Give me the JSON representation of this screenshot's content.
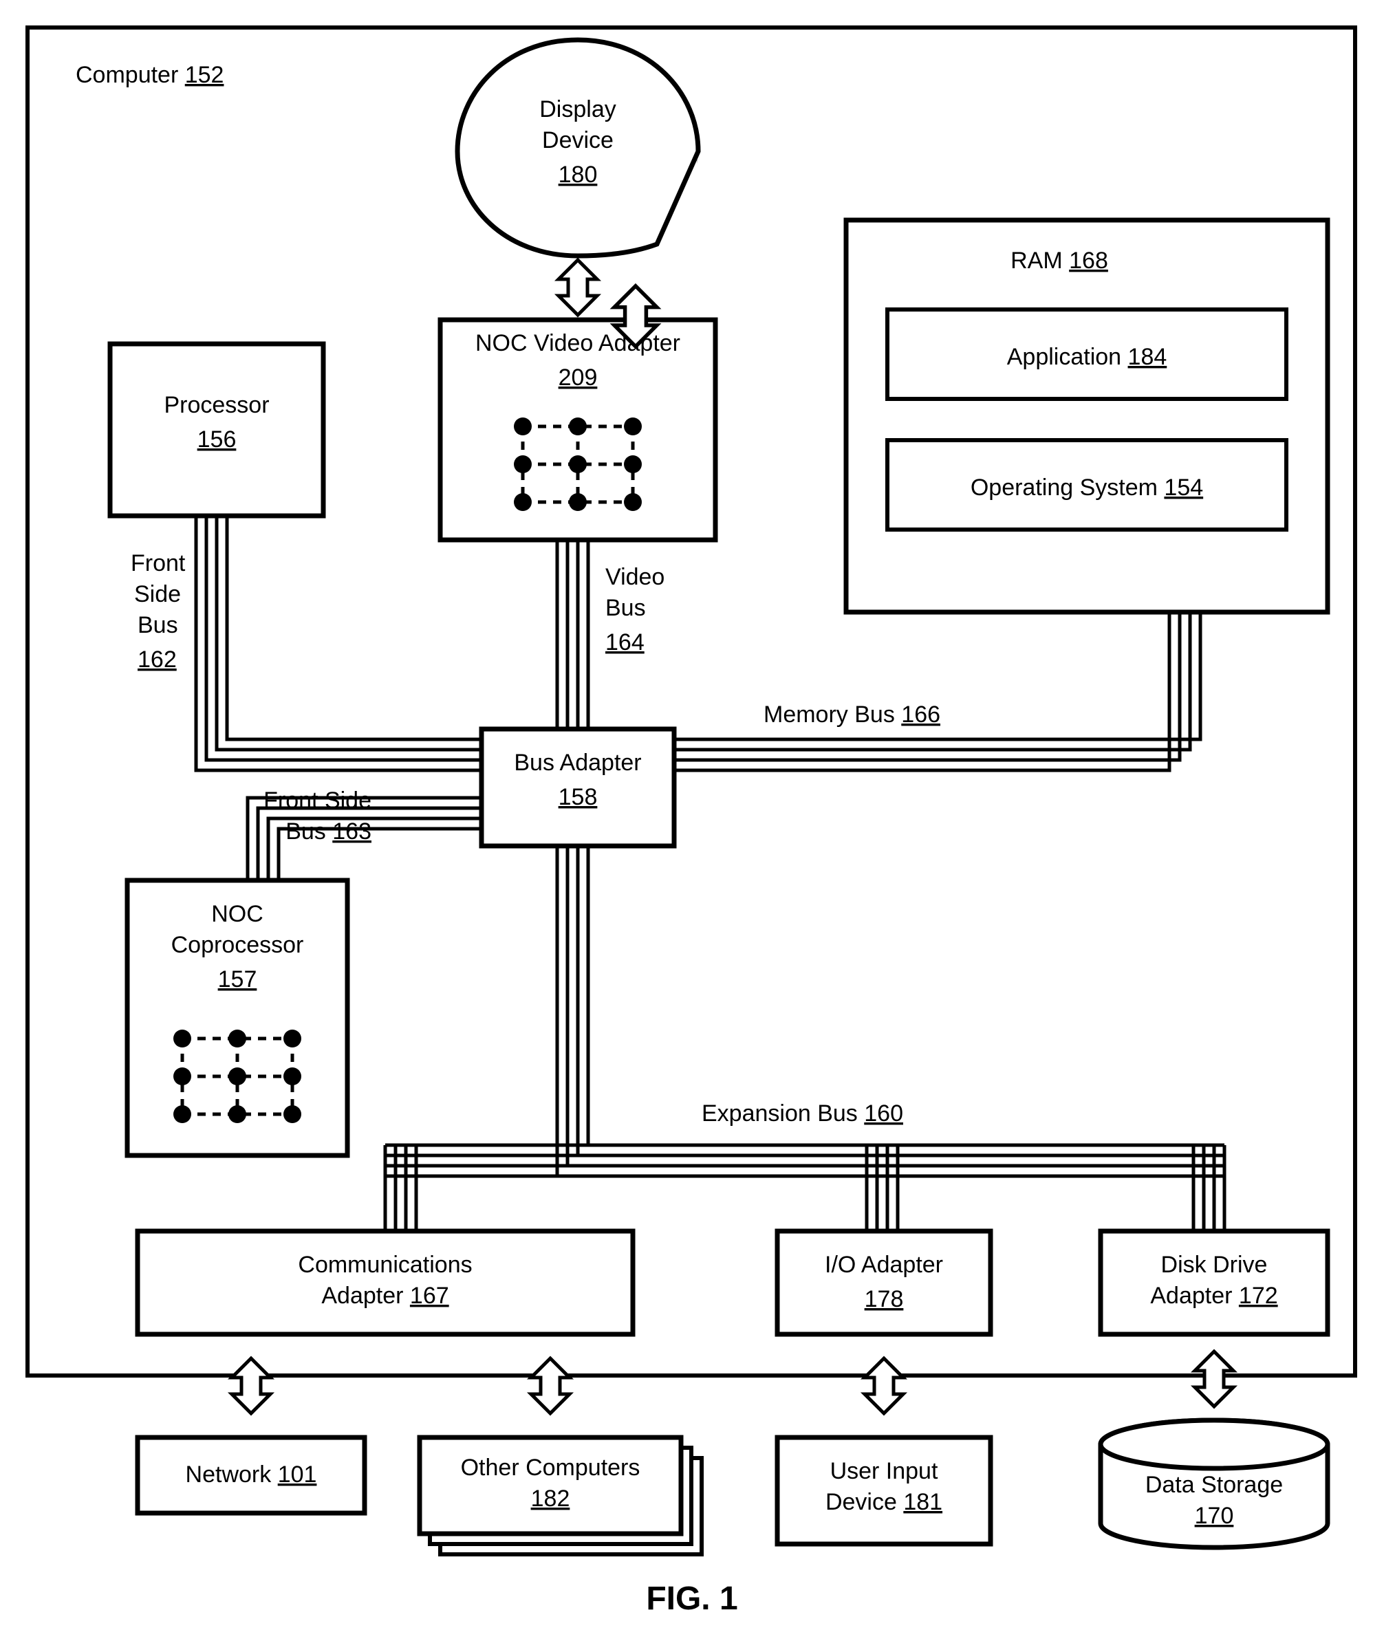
{
  "figure": {
    "label": "FIG. 1"
  },
  "computer": {
    "label": "Computer",
    "ref": "152"
  },
  "display": {
    "label1": "Display",
    "label2": "Device",
    "ref": "180"
  },
  "nocVideo": {
    "label": "NOC Video Adapter",
    "ref": "209"
  },
  "processor": {
    "label": "Processor",
    "ref": "156"
  },
  "ram": {
    "label": "RAM",
    "ref": "168"
  },
  "application": {
    "label": "Application",
    "ref": "184"
  },
  "os": {
    "label": "Operating System",
    "ref": "154"
  },
  "fsb1": {
    "l1": "Front",
    "l2": "Side",
    "l3": "Bus",
    "ref": "162"
  },
  "videoBus": {
    "l1": "Video",
    "l2": "Bus",
    "ref": "164"
  },
  "memBus": {
    "label": "Memory Bus",
    "ref": "166"
  },
  "busAdapter": {
    "label": "Bus Adapter",
    "ref": "158"
  },
  "fsb2": {
    "label": "Front Side",
    "l2": "Bus",
    "ref": "163"
  },
  "nocCop": {
    "l1": "NOC",
    "l2": "Coprocessor",
    "ref": "157"
  },
  "expBus": {
    "label": "Expansion Bus",
    "ref": "160"
  },
  "commAdapter": {
    "l1": "Communications",
    "l2": "Adapter",
    "ref": "167"
  },
  "ioAdapter": {
    "label": "I/O Adapter",
    "ref": "178"
  },
  "diskAdapter": {
    "l1": "Disk Drive",
    "l2": "Adapter",
    "ref": "172"
  },
  "network": {
    "label": "Network",
    "ref": "101"
  },
  "otherComp": {
    "label": "Other Computers",
    "ref": "182"
  },
  "userInput": {
    "l1": "User Input",
    "l2": "Device",
    "ref": "181"
  },
  "dataStorage": {
    "label": "Data Storage",
    "ref": "170"
  }
}
